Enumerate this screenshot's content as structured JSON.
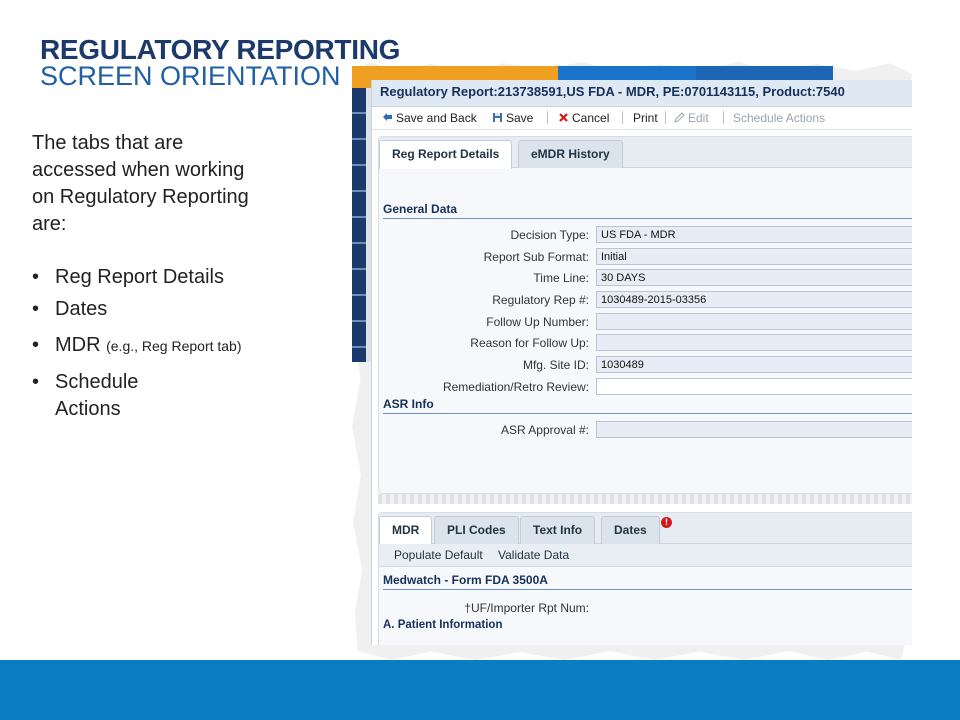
{
  "slide": {
    "title": "REGULATORY REPORTING",
    "subtitle": "SCREEN ORIENTATION",
    "intro": "The tabs that are accessed when working on Regulatory Reporting are:",
    "bullets": [
      {
        "main": "Reg Report Details",
        "note": ""
      },
      {
        "main": "Dates",
        "note": ""
      },
      {
        "main": "MDR",
        "note": "(e.g., Reg Report tab)"
      },
      {
        "main": "Schedule Actions",
        "note": ""
      }
    ]
  },
  "window": {
    "title": "Regulatory Report:213738591,US FDA - MDR, PE:0701143115, Product:7540",
    "toolbar": {
      "save_back": "Save and Back",
      "save": "Save",
      "cancel": "Cancel",
      "print": "Print",
      "edit": "Edit",
      "schedule": "Schedule Actions"
    },
    "top_tabs": [
      "Reg Report Details",
      "eMDR History"
    ],
    "general_data": {
      "heading": "General Data",
      "fields": [
        {
          "label": "Decision Type:",
          "value": "US FDA - MDR"
        },
        {
          "label": "Report Sub Format:",
          "value": "Initial"
        },
        {
          "label": "Time Line:",
          "value": "30 DAYS"
        },
        {
          "label": "Regulatory Rep #:",
          "value": "1030489-2015-03356"
        },
        {
          "label": "Follow Up Number:",
          "value": ""
        },
        {
          "label": "Reason for Follow Up:",
          "value": ""
        },
        {
          "label": "Mfg. Site ID:",
          "value": "1030489"
        },
        {
          "label": "Remediation/Retro Review:",
          "value": ""
        }
      ]
    },
    "asr_info": {
      "heading": "ASR Info",
      "fields": [
        {
          "label": "ASR Approval #:",
          "value": ""
        }
      ]
    },
    "bottom_tabs": [
      "MDR",
      "PLI Codes",
      "Text Info",
      "Dates"
    ],
    "alert_badge": "!",
    "subtoolbar": {
      "populate": "Populate Default",
      "validate": "Validate Data"
    },
    "medwatch": {
      "heading": "Medwatch - Form FDA 3500A",
      "importer_label": "†UF/Importer Rpt Num:",
      "patient_heading": "A. Patient Information"
    }
  },
  "colors": {
    "title": "#1b3a6b",
    "subtitle": "#1f5fa6",
    "footer": "#0a7cc1",
    "alert": "#d11a1a"
  }
}
